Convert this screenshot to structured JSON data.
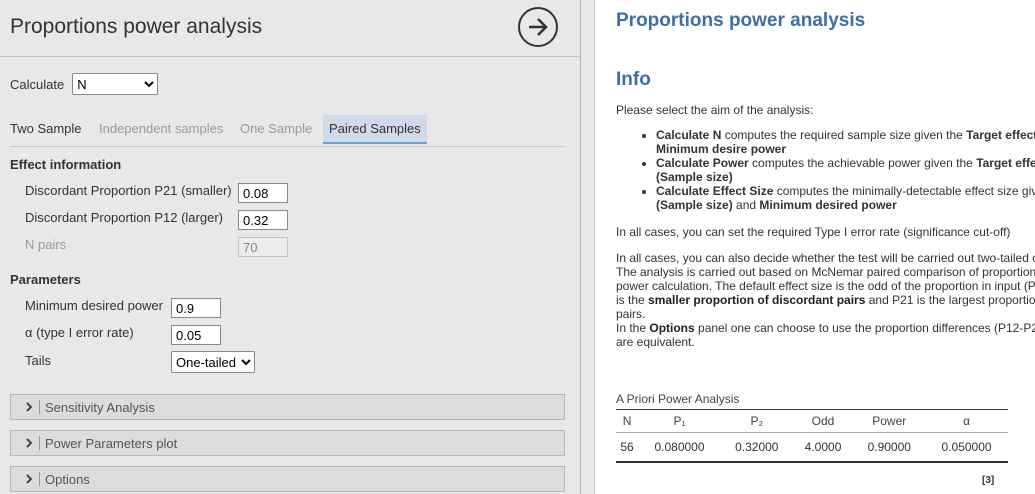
{
  "left": {
    "title": "Proportions power analysis",
    "calculate_label": "Calculate",
    "calculate_value": "N",
    "tabs": [
      "Two Sample",
      "Independent samples",
      "One Sample",
      "Paired Samples"
    ],
    "effect_header": "Effect information",
    "p21_label": "Discordant Proportion P21 (smaller)",
    "p21_value": "0.08",
    "p12_label": "Discordant Proportion P12 (larger)",
    "p12_value": "0.32",
    "npairs_label": "N pairs",
    "npairs_value": "70",
    "params_header": "Parameters",
    "power_label": "Minimum desired power",
    "power_value": "0.9",
    "alpha_label": "α (type I error rate)",
    "alpha_value": "0.05",
    "tails_label": "Tails",
    "tails_value": "One-tailed",
    "sections": [
      "Sensitivity Analysis",
      "Power Parameters plot",
      "Options"
    ]
  },
  "right": {
    "title": "Proportions power analysis",
    "info_header": "Info",
    "intro": "Please select the aim of the analysis:",
    "b1_bold": "Calculate N",
    "b1_text": " computes the required sample size given the ",
    "b1_bold2": "Target effect",
    "b1_line2": "Minimum desire power",
    "b2_bold": "Calculate Power",
    "b2_text": " computes the achievable power given the ",
    "b2_bold2": "Target effe",
    "b2_line2": "(Sample size)",
    "b3_bold": "Calculate Effect Size",
    "b3_text": " computes the minimally-detectable effect size giv",
    "b3_line2a": "(Sample size)",
    "b3_line2b": " and ",
    "b3_line2c": "Minimum desired power",
    "p1": "In all cases, you can set the required Type I error rate (significance cut-off)",
    "p2_l1": "In all cases, you can also decide whether the test will be carried out two-tailed o",
    "p2_l2": "The analysis is carried out based on McNemar paired comparison of proportion",
    "p2_l3": "power calculation. The default effect size is the odd of the proportion in input (P",
    "p2_l4a": "is the ",
    "p2_l4b": "smaller proportion of discordant pairs",
    "p2_l4c": " and P21 is the largest proportion",
    "p2_l5": "pairs.",
    "p2_l6a": "In the ",
    "p2_l6b": "Options",
    "p2_l6c": " panel one can choose to use the proportion differences (P12-P2",
    "p2_l7": "are equivalent.",
    "table_title": "A Priori Power Analysis",
    "table_headers": [
      "N",
      "P₁",
      "P₂",
      "Odd",
      "Power",
      "α"
    ],
    "table_row": [
      "56",
      "0.080000",
      "0.32000",
      "4.0000",
      "0.90000",
      "0.050000"
    ],
    "footnote": "[3]"
  }
}
